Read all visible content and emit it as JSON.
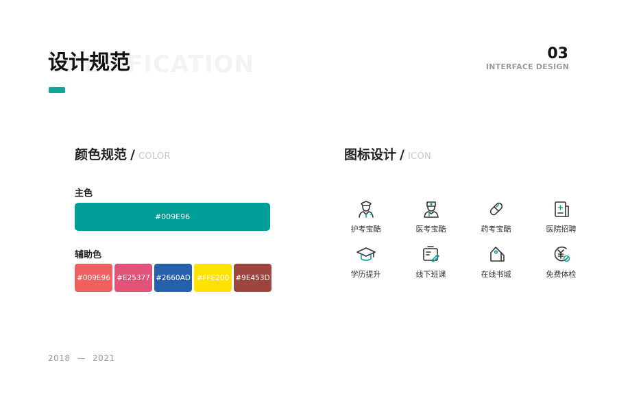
{
  "header": {
    "title": "设计规范",
    "watermark": "SPECIFICATION",
    "page_number": "03",
    "page_subtitle": "INTERFACE DESIGN",
    "accent_color": "#12A39B"
  },
  "color_section": {
    "title": "颜色规范",
    "separator": "/",
    "title_en": "COLOR",
    "primary_label": "主色",
    "primary": {
      "hex": "#009E96",
      "color": "#009E96"
    },
    "secondary_label": "辅助色",
    "secondary": [
      {
        "hex": "#009E96",
        "color": "#F0605F"
      },
      {
        "hex": "#E25377",
        "color": "#E25377"
      },
      {
        "hex": "#2660AD",
        "color": "#2660AD"
      },
      {
        "hex": "#FFE200",
        "color": "#FFE200"
      },
      {
        "hex": "#9E453D",
        "color": "#9E453D"
      }
    ]
  },
  "icon_section": {
    "title": "图标设计",
    "separator": "/",
    "title_en": "ICON",
    "icons": [
      {
        "label": "护考宝酷",
        "icon": "nurse-icon"
      },
      {
        "label": "医考宝酷",
        "icon": "doctor-icon"
      },
      {
        "label": "药考宝酷",
        "icon": "pill-icon"
      },
      {
        "label": "医院招聘",
        "icon": "hospital-document-icon"
      },
      {
        "label": "学历提升",
        "icon": "graduation-cap-icon"
      },
      {
        "label": "线下班课",
        "icon": "classroom-icon"
      },
      {
        "label": "在线书城",
        "icon": "bookstore-tag-icon"
      },
      {
        "label": "免费体检",
        "icon": "free-checkup-icon"
      }
    ]
  },
  "footer": {
    "year_start": "2018",
    "dash": "—",
    "year_end": "2021"
  }
}
